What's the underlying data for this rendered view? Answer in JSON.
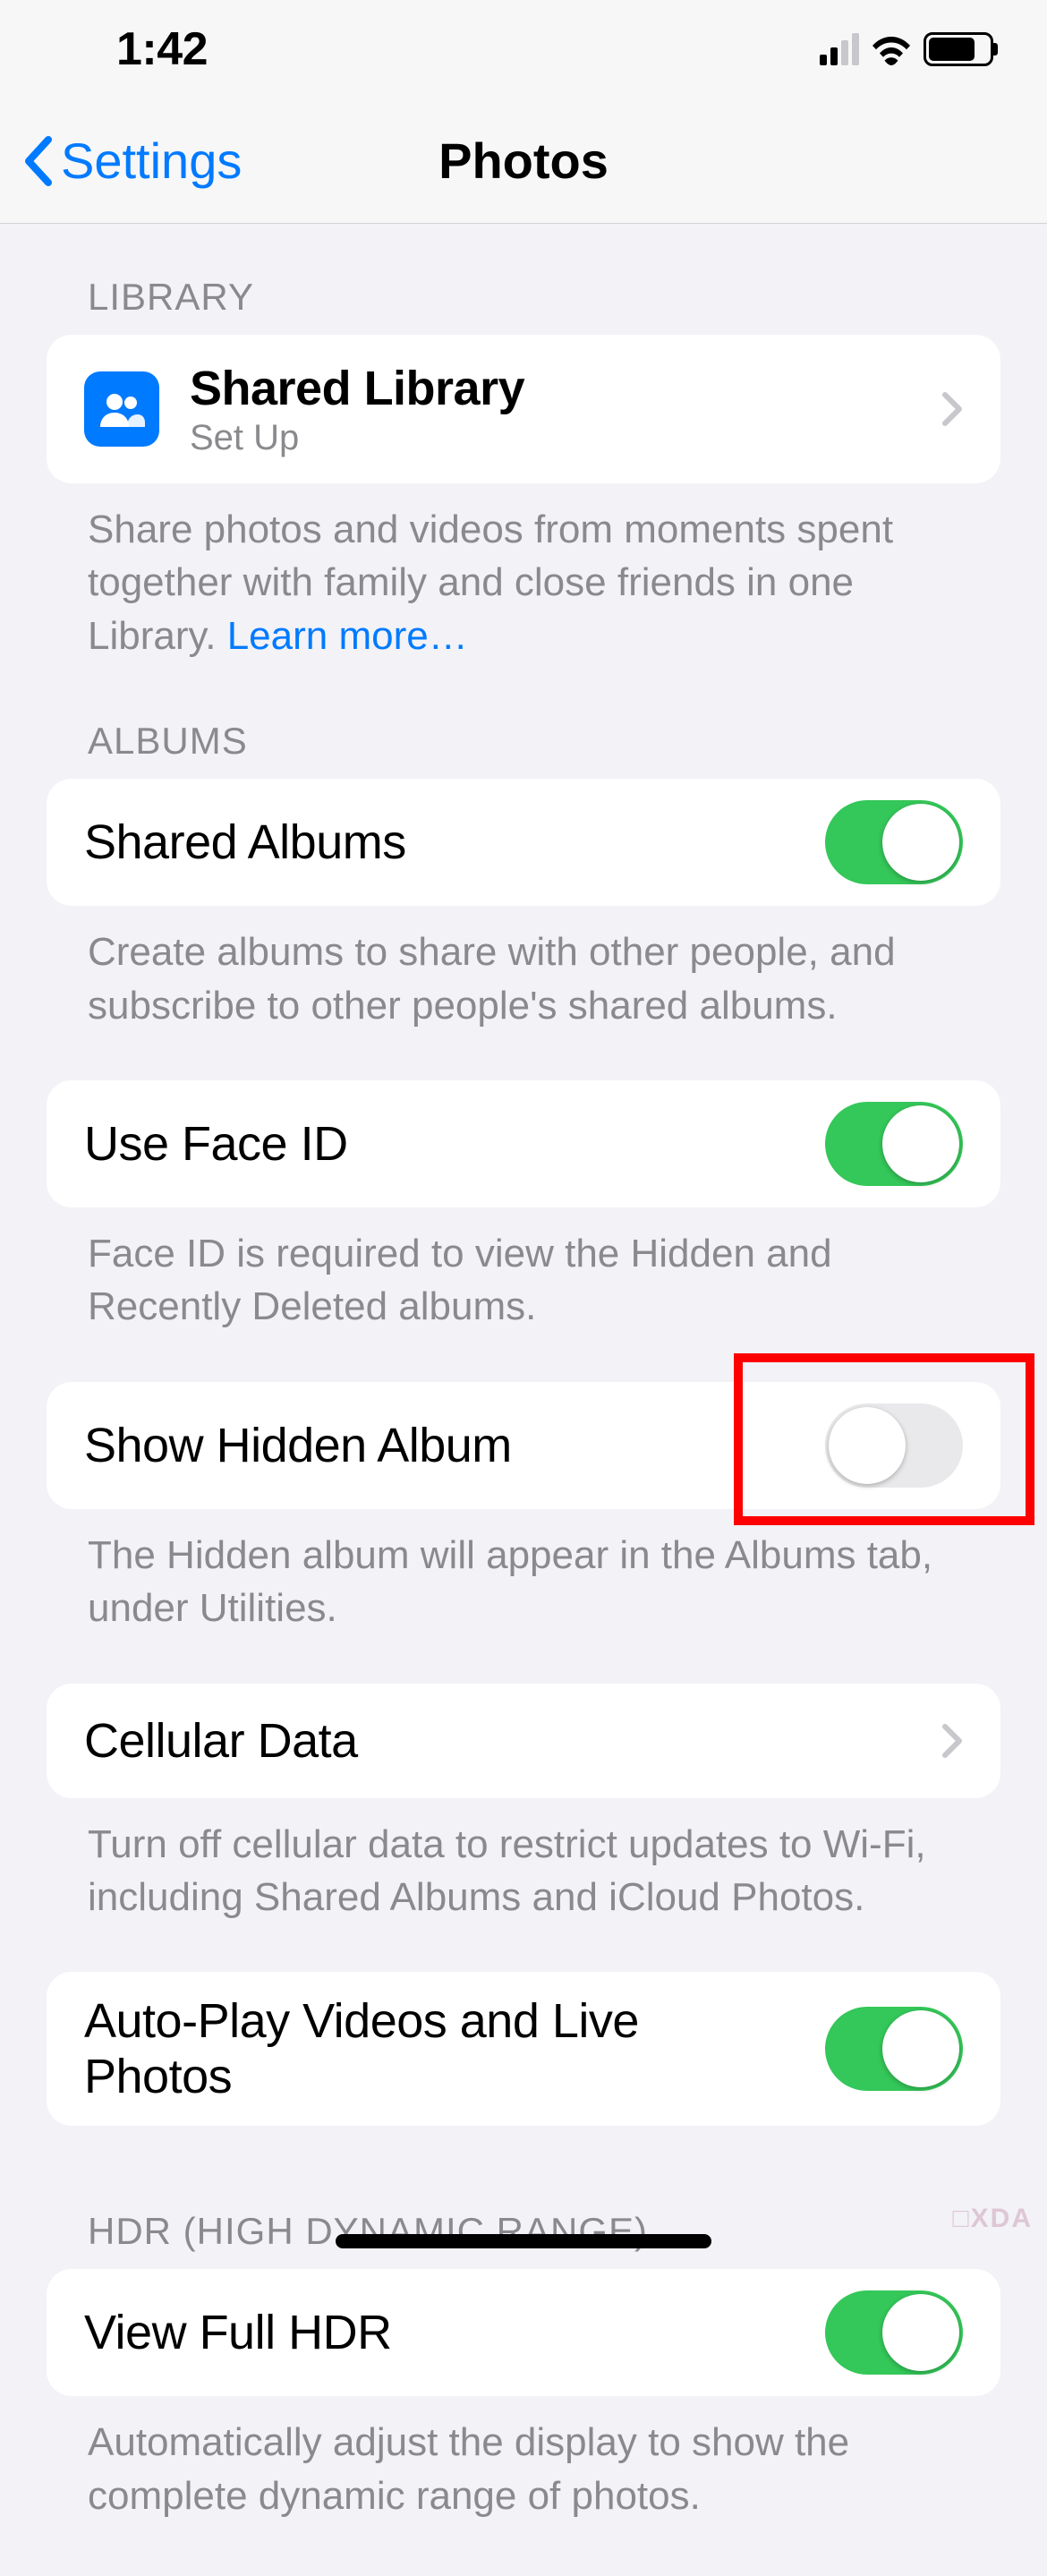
{
  "status": {
    "time": "1:42"
  },
  "nav": {
    "back": "Settings",
    "title": "Photos"
  },
  "sections": {
    "library": {
      "header": "LIBRARY",
      "shared_library": {
        "title": "Shared Library",
        "subtitle": "Set Up"
      },
      "footer": "Share photos and videos from moments spent together with family and close friends in one Library. ",
      "learn_more": "Learn more…"
    },
    "albums": {
      "header": "ALBUMS",
      "shared_albums": {
        "title": "Shared Albums",
        "on": true
      },
      "shared_albums_footer": "Create albums to share with other people, and subscribe to other people's shared albums.",
      "use_face_id": {
        "title": "Use Face ID",
        "on": true
      },
      "use_face_id_footer": "Face ID is required to view the Hidden and Recently Deleted albums.",
      "show_hidden": {
        "title": "Show Hidden Album",
        "on": false
      },
      "show_hidden_footer": "The Hidden album will appear in the Albums tab, under Utilities.",
      "cellular": {
        "title": "Cellular Data"
      },
      "cellular_footer": "Turn off cellular data to restrict updates to Wi-Fi, including Shared Albums and iCloud Photos.",
      "autoplay": {
        "title": "Auto-Play Videos and Live Photos",
        "on": true
      }
    },
    "hdr": {
      "header": "HDR (HIGH DYNAMIC RANGE)",
      "view_full_hdr": {
        "title": "View Full HDR",
        "on": true
      },
      "footer": "Automatically adjust the display to show the complete dynamic range of photos."
    }
  },
  "watermark": "□XDA"
}
